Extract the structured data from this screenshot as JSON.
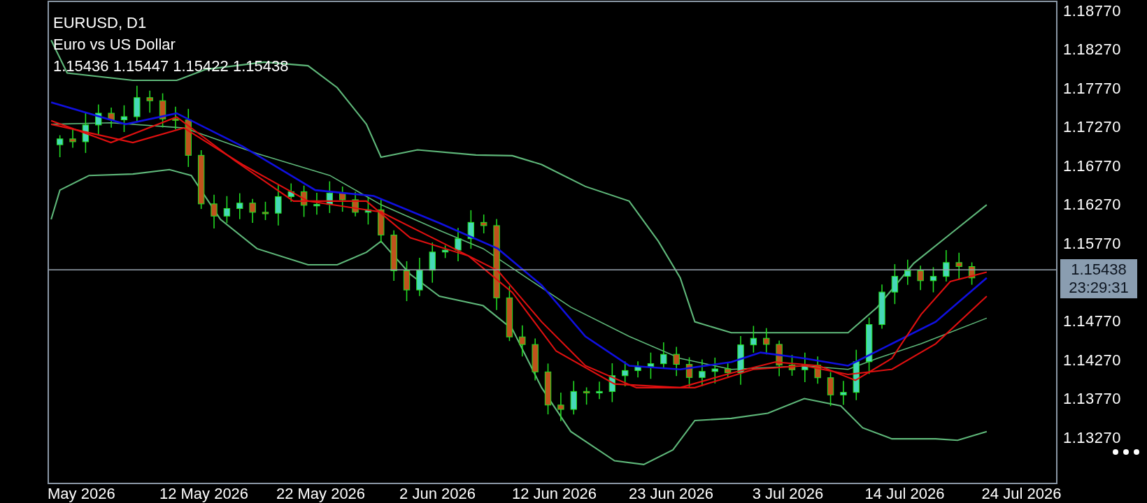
{
  "header": {
    "symbol": "EURUSD, D1",
    "description": "Euro vs US Dollar",
    "ohlc": "1.15436 1.15447 1.15422 1.15438"
  },
  "price_axis": {
    "labels_above": [
      "1.18770",
      "1.18270",
      "1.17770",
      "1.17270",
      "1.16770",
      "1.16270",
      "1.15770"
    ],
    "labels_below": [
      "1.14770",
      "1.14270",
      "1.13770",
      "1.13270"
    ]
  },
  "current_price": {
    "price": "1.15438",
    "countdown": "23:29:31"
  },
  "time_axis": {
    "labels": [
      "May 2026",
      "12 May 2026",
      "22 May 2026",
      "2 Jun 2026",
      "12 Jun 2026",
      "23 Jun 2026",
      "3 Jul 2026",
      "14 Jul 2026",
      "24 Jul 2026"
    ]
  }
}
